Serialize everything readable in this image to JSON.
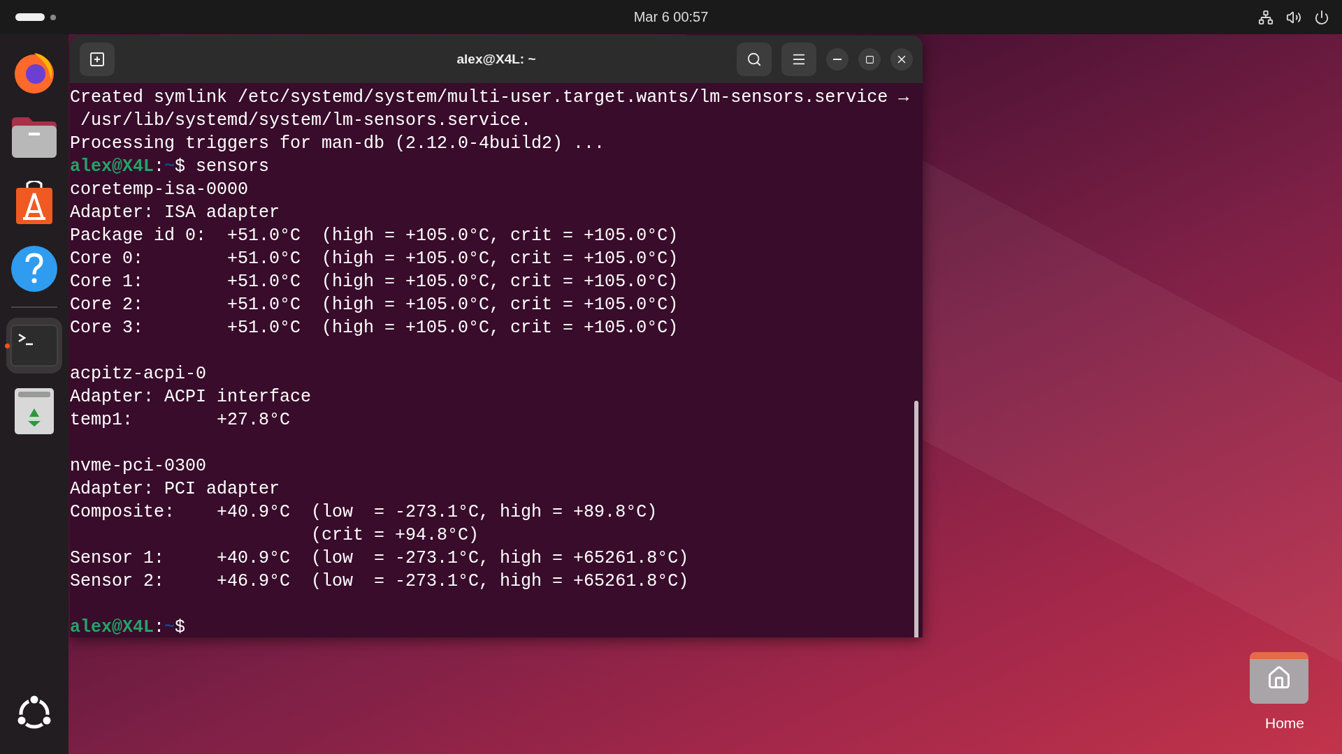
{
  "top_bar": {
    "clock": "Mar 6  00:57"
  },
  "dock": {
    "items": [
      {
        "kind": "browser",
        "running": false
      },
      {
        "kind": "files",
        "running": false
      },
      {
        "kind": "store",
        "running": false
      },
      {
        "kind": "help",
        "running": false
      },
      {
        "kind": "terminal",
        "running": true
      },
      {
        "kind": "trash",
        "running": false
      }
    ]
  },
  "terminal": {
    "title": "alex@X4L: ~",
    "lines": [
      {
        "kind": "output",
        "text": "Created symlink /etc/systemd/system/multi-user.target.wants/lm-sensors.service →"
      },
      {
        "kind": "output",
        "text": " /usr/lib/systemd/system/lm-sensors.service."
      },
      {
        "kind": "output",
        "text": "Processing triggers for man-db (2.12.0-4build2) ..."
      },
      {
        "kind": "prompt",
        "user": "alex@X4L",
        "separator": ":",
        "path": "~",
        "symbol": "$",
        "command": "sensors"
      },
      {
        "kind": "output",
        "text": "coretemp-isa-0000"
      },
      {
        "kind": "output",
        "text": "Adapter: ISA adapter"
      },
      {
        "kind": "output",
        "text": "Package id 0:  +51.0°C  (high = +105.0°C, crit = +105.0°C)"
      },
      {
        "kind": "output",
        "text": "Core 0:        +51.0°C  (high = +105.0°C, crit = +105.0°C)"
      },
      {
        "kind": "output",
        "text": "Core 1:        +51.0°C  (high = +105.0°C, crit = +105.0°C)"
      },
      {
        "kind": "output",
        "text": "Core 2:        +51.0°C  (high = +105.0°C, crit = +105.0°C)"
      },
      {
        "kind": "output",
        "text": "Core 3:        +51.0°C  (high = +105.0°C, crit = +105.0°C)"
      },
      {
        "kind": "blank"
      },
      {
        "kind": "output",
        "text": "acpitz-acpi-0"
      },
      {
        "kind": "output",
        "text": "Adapter: ACPI interface"
      },
      {
        "kind": "output",
        "text": "temp1:        +27.8°C"
      },
      {
        "kind": "blank"
      },
      {
        "kind": "output",
        "text": "nvme-pci-0300"
      },
      {
        "kind": "output",
        "text": "Adapter: PCI adapter"
      },
      {
        "kind": "output",
        "text": "Composite:    +40.9°C  (low  = -273.1°C, high = +89.8°C)"
      },
      {
        "kind": "output",
        "text": "                       (crit = +94.8°C)"
      },
      {
        "kind": "output",
        "text": "Sensor 1:     +40.9°C  (low  = -273.1°C, high = +65261.8°C)"
      },
      {
        "kind": "output",
        "text": "Sensor 2:     +46.9°C  (low  = -273.1°C, high = +65261.8°C)"
      },
      {
        "kind": "blank"
      },
      {
        "kind": "prompt",
        "user": "alex@X4L",
        "separator": ":",
        "path": "~",
        "symbol": "$"
      }
    ]
  },
  "desktop": {
    "icons": [
      {
        "label": "Home"
      }
    ]
  }
}
